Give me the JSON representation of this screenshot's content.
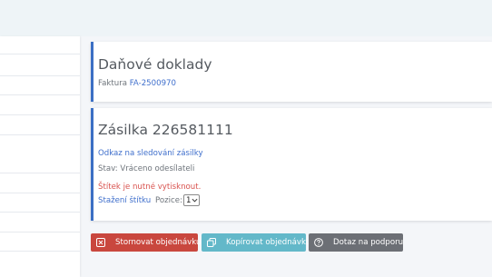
{
  "cards": {
    "tax_documents": {
      "title": "Daňové doklady",
      "invoice_prefix": "Faktura ",
      "invoice_number": "FA-2500970"
    },
    "shipment": {
      "title": "Zásilka 226581111",
      "tracking_link": "Odkaz na sledování zásilky",
      "status": "Stav: Vráceno odesílateli",
      "label_warning": "Štítek je nutné vytisknout.",
      "label_download": "Stažení štítku",
      "position_label": "Pozice:",
      "position_value": "1"
    }
  },
  "actions": {
    "cancel_label": "Stornovat objednávku",
    "copy_label": "Kopírovat objednávku",
    "support_label": "Dotaz na podporu"
  },
  "icons": {
    "cancel": "close-square-icon",
    "copy": "copy-icon",
    "support": "question-circle-icon"
  },
  "colors": {
    "accent": "#3b6fc4",
    "link": "#3f6fcc",
    "warning": "#d9534f",
    "cancel_button": "#c9473e",
    "copy_button": "#63b8c9",
    "support_button": "#6c6f75"
  }
}
